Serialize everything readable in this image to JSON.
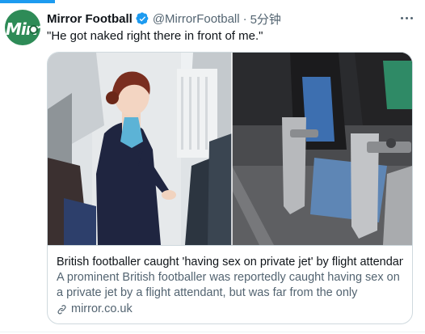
{
  "account": {
    "name": "Mirror Football",
    "handle": "@MirrorFootball",
    "separator": "·",
    "time": "5分钟",
    "avatar_text": "Mirr",
    "verified_icon": "verified-badge-icon"
  },
  "tweet": {
    "text": "\"He got naked right there in front of me.\""
  },
  "card": {
    "title": "British footballer caught 'having sex on private jet' by flight attendant",
    "description": "A prominent British footballer was reportedly caught having sex on a private jet by a flight attendant, but was far from the only footballer ...",
    "domain": "mirror.co.uk",
    "domain_icon": "link-icon"
  },
  "colors": {
    "accent": "#1d9bf0",
    "text_primary": "#0f1419",
    "text_secondary": "#536471",
    "border": "#cfd9de",
    "avatar_bg": "#2e8b57"
  }
}
